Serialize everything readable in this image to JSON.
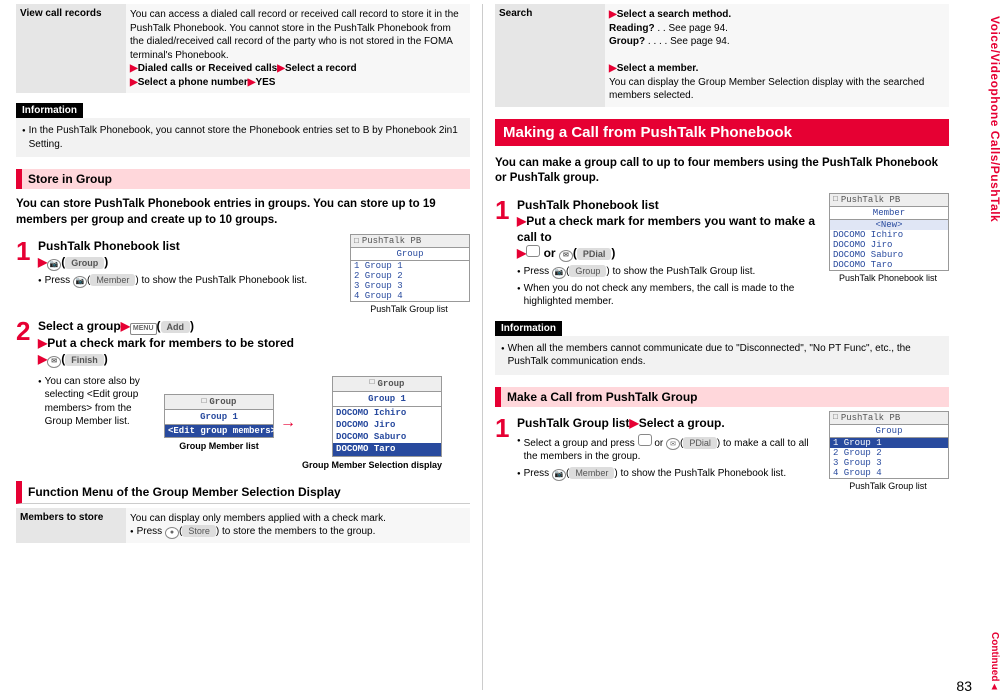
{
  "sideTab": "Voice/Videophone Calls/PushTalk",
  "continued": "Continued",
  "pageNum": "83",
  "left": {
    "viewCall": {
      "label": "View call records",
      "body": "You can access a dialed call record or received call record to store it in the PushTalk Phonebook. You cannot store in the PushTalk Phonebook from the dialed/received call record of the party who is not stored in the FOMA terminal's Phonebook.",
      "line1a": "Dialed calls or Received calls",
      "line1b": "Select a record",
      "line2a": "Select a phone number",
      "line2b": "YES"
    },
    "infoHd": "Information",
    "info1": "In the PushTalk Phonebook, you cannot store the Phonebook entries set to B by Phonebook 2in1 Setting.",
    "storeHd": "Store in Group",
    "storeLead": "You can store PushTalk Phonebook entries in groups. You can store up to 19 members per group and create up to 10 groups.",
    "step1": {
      "title": "PushTalk Phonebook list",
      "btn": "Group",
      "sub": "Press ",
      "subBtn": "Member",
      "sub2": " to show the PushTalk Phonebook list."
    },
    "shot1": {
      "title": "PushTalk PB",
      "sub": "Group",
      "rows": [
        "1 Group 1",
        "2 Group 2",
        "3 Group 3",
        "4 Group 4"
      ],
      "cap": "PushTalk Group list"
    },
    "step2": {
      "line1a": "Select a group",
      "line1menu": "MENU",
      "line1btn": "Add",
      "line2": "Put a check mark for members to be stored",
      "line3btn": "Finish",
      "subText": "You can store also by selecting <Edit group members> from the Group Member list."
    },
    "shotA": {
      "title": "Group",
      "sub": "Group 1",
      "rows": [
        "<Edit group members>"
      ],
      "cap": "Group Member list"
    },
    "shotB": {
      "title": "Group",
      "sub": "Group 1",
      "rows": [
        "DOCOMO Ichiro",
        "DOCOMO Jiro",
        "DOCOMO Saburo",
        "DOCOMO Taro"
      ],
      "cap": "Group Member Selection display"
    },
    "funcHd": "Function Menu of the Group Member Selection Display",
    "members": {
      "label": "Members to store",
      "body": "You can display only members applied with a check mark.",
      "sub": "Press ",
      "btn": "Store",
      "sub2": " to store the members to the group."
    }
  },
  "right": {
    "search": {
      "label": "Search",
      "line1": "Select a search method.",
      "r1a": "Reading?",
      "r1b": ". .  See page 94.",
      "r2a": "Group?",
      "r2b": ". . . .  See page 94.",
      "line2": "Select a member.",
      "body": "You can display the Group Member Selection display with the searched members selected."
    },
    "bigHd": "Making a Call from PushTalk Phonebook",
    "bigLead": "You can make a group call to up to four members using the PushTalk Phonebook or PushTalk group.",
    "step1": {
      "l1": "PushTalk Phonebook list",
      "l2": "Put a check mark for members you want to make a call to",
      "or": " or ",
      "btn": "PDial",
      "sub1": "Press ",
      "sub1btn": "Group",
      "sub1b": " to show the PushTalk Group list.",
      "sub2": "When you do not check any members, the call is made to the highlighted member."
    },
    "shotPB": {
      "title": "PushTalk PB",
      "sub": "Member",
      "newrow": "<New>",
      "rows": [
        "DOCOMO Ichiro",
        "DOCOMO Jiro",
        "DOCOMO Saburo",
        "DOCOMO Taro"
      ],
      "cap": "PushTalk Phonebook list"
    },
    "infoHd": "Information",
    "info2": "When all the members cannot communicate due to \"Disconnected\", \"No PT Func\", etc., the PushTalk communication ends.",
    "makeHd": "Make a Call from PushTalk Group",
    "mstep": {
      "l1a": "PushTalk Group list",
      "l1b": "Select a group.",
      "sub1a": "Select a group and press ",
      "sub1b": " or ",
      "sub1btn": "PDial",
      "sub1c": " to make a call to all the members in the group.",
      "sub2a": "Press ",
      "sub2btn": "Member",
      "sub2b": " to show the PushTalk Phonebook list."
    },
    "shotG": {
      "title": "PushTalk PB",
      "sub": "Group",
      "rows": [
        "1 Group 1",
        "2 Group 2",
        "3 Group 3",
        "4 Group 4"
      ],
      "highlight": 0,
      "cap": "PushTalk Group list"
    }
  }
}
